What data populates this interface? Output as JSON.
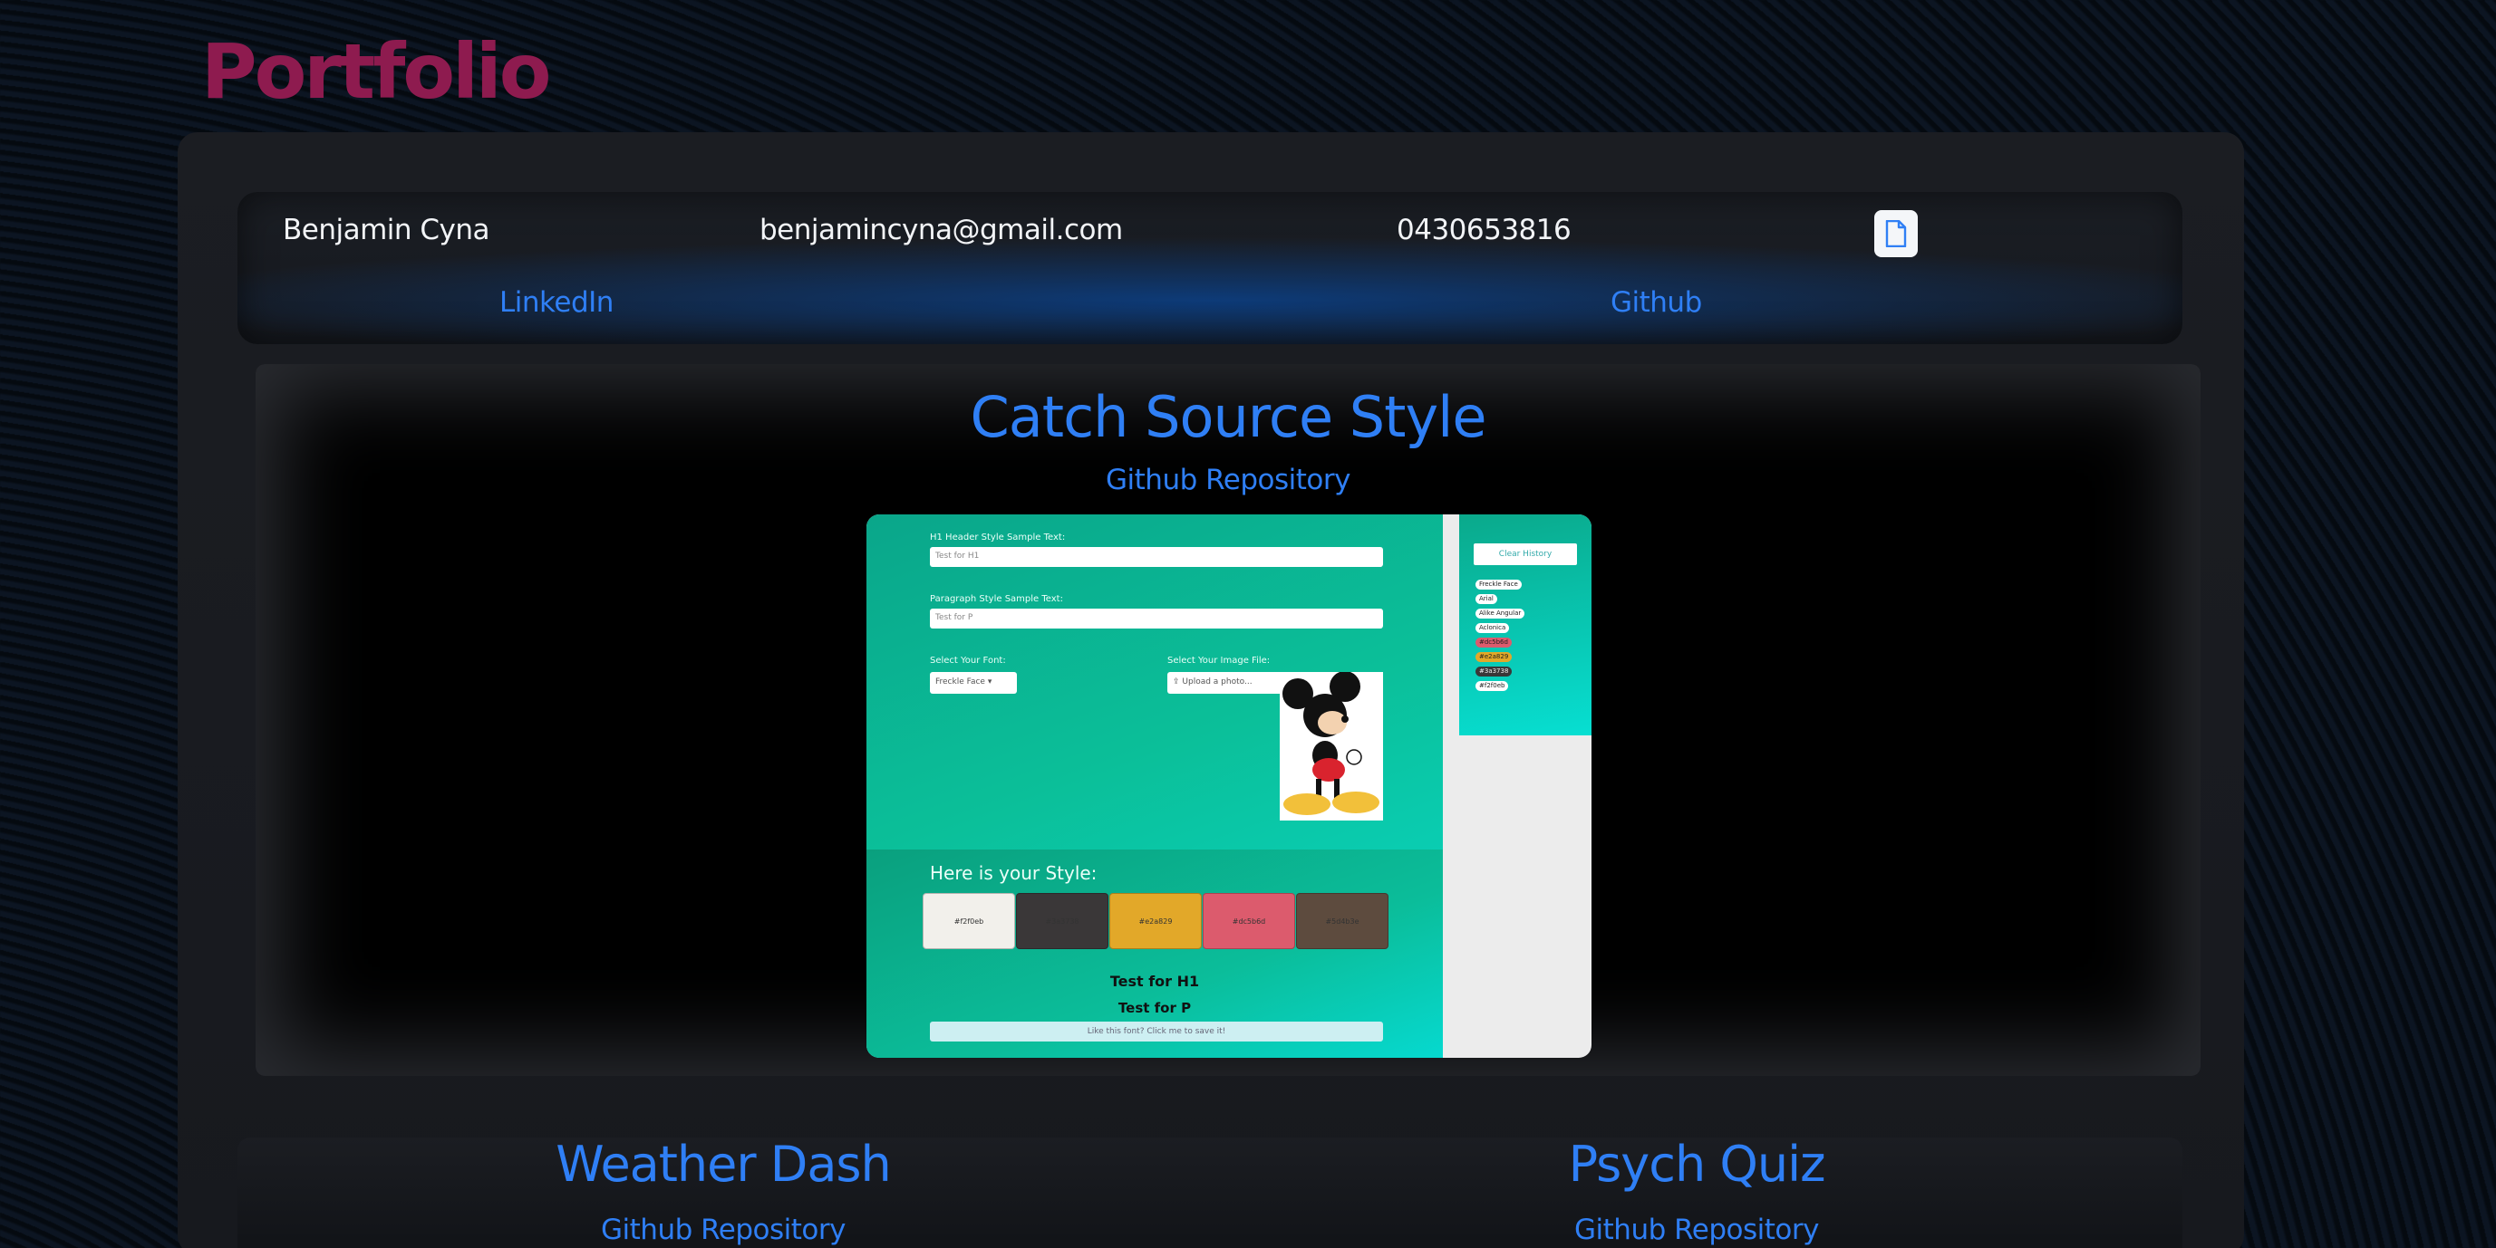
{
  "brand": {
    "title": "Portfolio"
  },
  "contact": {
    "name": "Benjamin Cyna",
    "email": "benjamincyna@gmail.com",
    "phone": "0430653816",
    "linkedin_label": "LinkedIn",
    "github_label": "Github",
    "resume_icon": "document-icon"
  },
  "featured_project": {
    "title": "Catch Source Style",
    "repo_label": "Github Repository",
    "screenshot": {
      "h1_label": "H1 Header Style Sample Text:",
      "h1_value": "Test for H1",
      "p_label": "Paragraph Style Sample Text:",
      "p_value": "Test for P",
      "font_label": "Select Your Font:",
      "font_value": "Freckle Face",
      "image_label": "Select Your Image File:",
      "upload_label": "Upload a photo...",
      "style_heading": "Here is your Style:",
      "swatches": [
        {
          "hex": "#f2f0eb",
          "color": "#f2f0eb"
        },
        {
          "hex": "#3a3738",
          "color": "#3a3738"
        },
        {
          "hex": "#e2a829",
          "color": "#e2a829"
        },
        {
          "hex": "#dc5b6d",
          "color": "#dc5b6d"
        },
        {
          "hex": "#5d4b3e",
          "color": "#5d4b3e"
        }
      ],
      "preview_h1": "Test for H1",
      "preview_p": "Test for P",
      "save_label": "Like this font? Click me to save it!",
      "clear_label": "Clear History",
      "history": [
        "Freckle Face",
        "Arial",
        "Alike Angular",
        "Aclonica",
        "#dc5b6d",
        "#e2a829",
        "#3a3738",
        "#f2f0eb"
      ]
    }
  },
  "projects": [
    {
      "title": "Weather Dash",
      "repo_label": "Github Repository"
    },
    {
      "title": "Psych Quiz",
      "repo_label": "Github Repository"
    }
  ],
  "colors": {
    "accent": "#2f7ff5",
    "brand": "#8e1b4f",
    "panel": "#1b1d22"
  }
}
